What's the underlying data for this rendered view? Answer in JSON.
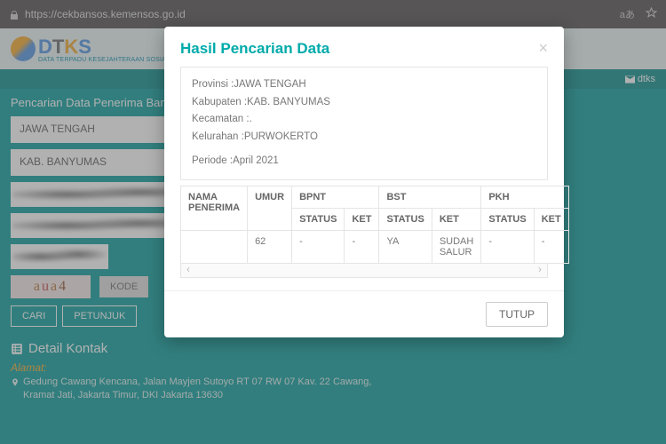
{
  "browser": {
    "url": "https://cekbansos.kemensos.go.id",
    "lang_badge": "aあ"
  },
  "logo": {
    "text": "DTKS",
    "subtitle": "DATA TERPADU KESEJAHTERAAN SOSIAL"
  },
  "topbar": {
    "dtks_link": "dtks"
  },
  "search": {
    "title": "Pencarian Data Penerima Bantuan Sosial",
    "field1": "JAWA TENGAH",
    "field2": "KAB. BANYUMAS",
    "captcha": "aua4",
    "kode_btn": "KODE",
    "cari_btn": "CARI",
    "petunjuk_btn": "PETUNJUK"
  },
  "contact": {
    "title": "Detail Kontak",
    "alamat_label": "Alamat:",
    "alamat_text": "Gedung Cawang Kencana, Jalan Mayjen Sutoyo RT 07 RW 07 Kav. 22 Cawang, Kramat Jati, Jakarta Timur, DKI Jakarta 13630"
  },
  "modal": {
    "title": "Hasil Pencarian Data",
    "info": {
      "provinsi_label": "Provinsi : ",
      "provinsi_value": "JAWA TENGAH",
      "kabupaten_label": "Kabupaten : ",
      "kabupaten_value": "KAB. BANYUMAS",
      "kecamatan_label": "Kecamatan : ",
      "kecamatan_value": ".",
      "kelurahan_label": "Kelurahan : ",
      "kelurahan_value": "PURWOKERTO",
      "periode_label": "Periode : ",
      "periode_value": "April 2021"
    },
    "headers": {
      "nama": "NAMA PENERIMA",
      "umur": "UMUR",
      "bpnt": "BPNT",
      "bst": "BST",
      "pkh": "PKH",
      "status": "STATUS",
      "ket": "KET"
    },
    "row": {
      "nama": "",
      "umur": "62",
      "bpnt_status": "-",
      "bpnt_ket": "-",
      "bst_status": "YA",
      "bst_ket": "SUDAH SALUR",
      "pkh_status": "-",
      "pkh_ket": "-"
    },
    "tutup": "TUTUP"
  }
}
